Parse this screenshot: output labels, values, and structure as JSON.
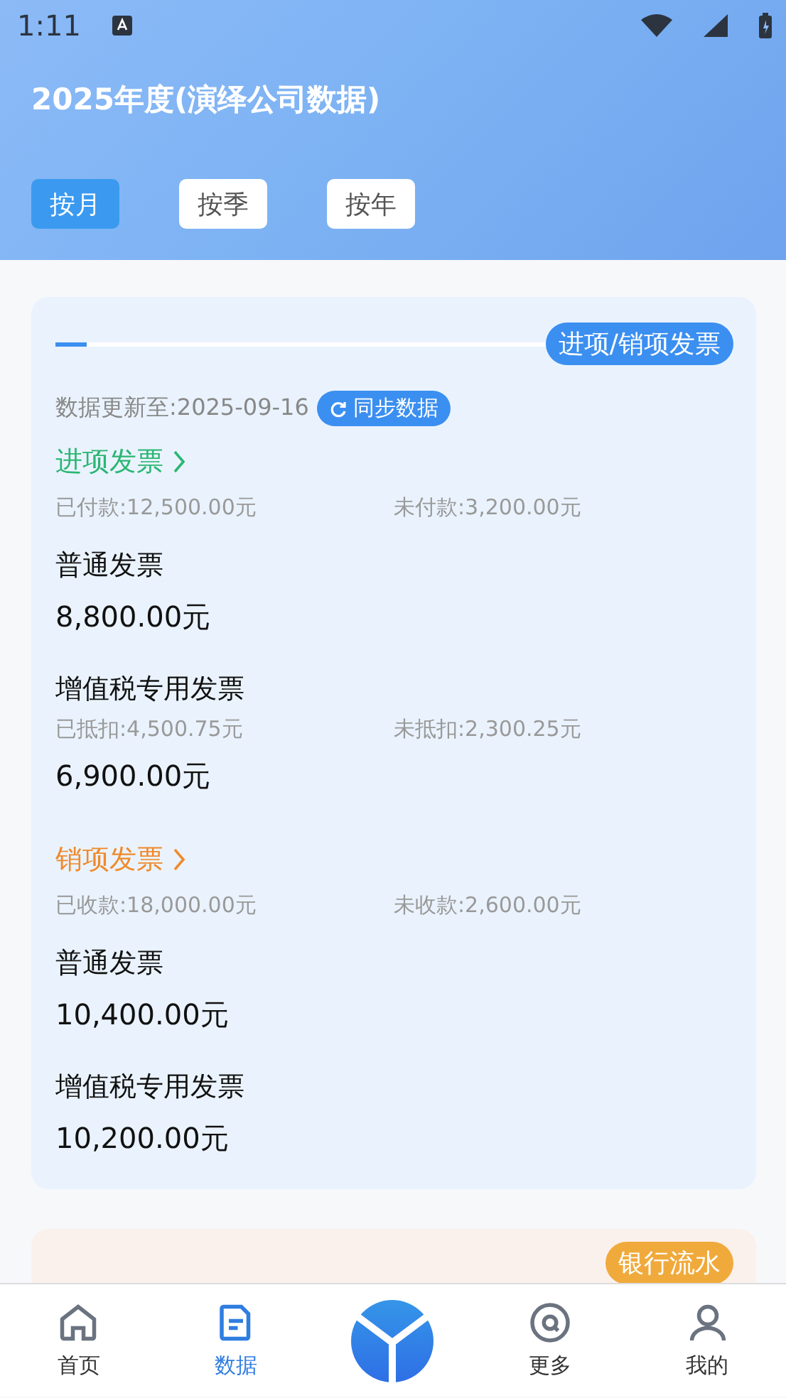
{
  "status_bar": {
    "time": "1:11"
  },
  "header": {
    "title": "2025年度(演绎公司数据)",
    "tabs": [
      {
        "label": "按月",
        "selected": true
      },
      {
        "label": "按季",
        "selected": false
      },
      {
        "label": "按年",
        "selected": false
      }
    ]
  },
  "invoice_card": {
    "badge": "进项/销项发票",
    "updated": "数据更新至:2025-09-16",
    "sync_button": "同步数据",
    "sections": [
      {
        "title": "进项发票",
        "color": "#2bb673",
        "summary": [
          "已付款:12,500.00元",
          "未付款:3,200.00元"
        ],
        "items": [
          {
            "label": "普通发票",
            "amount": "8,800.00元"
          },
          {
            "label": "增值税专用发票",
            "details": [
              "已抵扣:4,500.75元",
              "未抵扣:2,300.25元"
            ],
            "amount": "6,900.00元"
          }
        ]
      },
      {
        "title": "销项发票",
        "color": "#f08a2c",
        "summary": [
          "已收款:18,000.00元",
          "未收款:2,600.00元"
        ],
        "items": [
          {
            "label": "普通发票",
            "amount": "10,400.00元"
          },
          {
            "label": "增值税专用发票",
            "amount": "10,200.00元"
          }
        ]
      }
    ]
  },
  "bank_card": {
    "badge": "银行流水"
  },
  "bottom_nav": [
    {
      "kind": "tab",
      "label": "首页",
      "selected": false
    },
    {
      "kind": "tab",
      "label": "数据",
      "selected": true
    },
    {
      "kind": "logo"
    },
    {
      "kind": "tab",
      "label": "更多",
      "selected": false
    },
    {
      "kind": "tab",
      "label": "我的",
      "selected": false
    }
  ]
}
